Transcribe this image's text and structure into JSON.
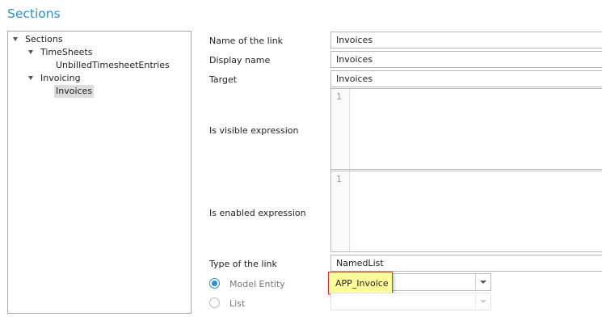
{
  "page": {
    "title": "Sections"
  },
  "tree": {
    "root": "Sections",
    "timesheets": "TimeSheets",
    "unbilled": "UnbilledTimesheetEntries",
    "invoicing": "Invoicing",
    "invoices": "Invoices"
  },
  "form": {
    "name_label": "Name of the link",
    "name_value": "Invoices",
    "display_label": "Display name",
    "display_value": "Invoices",
    "target_label": "Target",
    "target_value": "Invoices",
    "visible_label": "Is visible expression",
    "visible_line": "1",
    "enabled_label": "Is enabled expression",
    "enabled_line": "1",
    "type_label": "Type of the link",
    "type_value": "NamedList",
    "model_entity_label": "Model Entity",
    "model_entity_value": "APP_Invoice",
    "list_label": "List"
  },
  "colors": {
    "accent": "#2e8ec9",
    "highlight": "#ffff99",
    "highlight_border": "#d93535"
  }
}
